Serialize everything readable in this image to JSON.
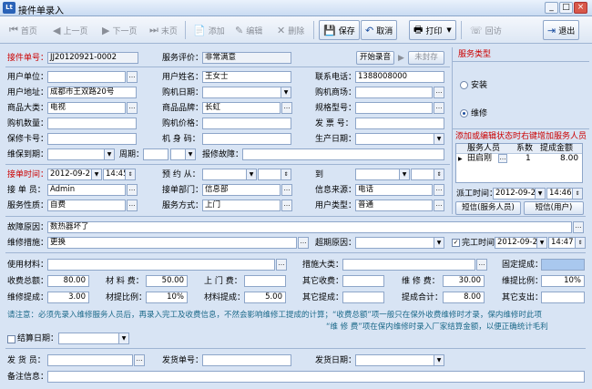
{
  "window": {
    "title": "接件单录入",
    "min": "_",
    "max": "□",
    "close": "×"
  },
  "toolbar": {
    "first": "首页",
    "prev": "上一页",
    "next": "下一页",
    "last": "末页",
    "add": "添加",
    "edit": "编辑",
    "del": "删除",
    "save": "保存",
    "cancel": "取消",
    "print": "打印",
    "visit": "回访",
    "exit": "退出"
  },
  "form": {
    "order_no_label": "接件单号：",
    "order_no": "JJ20120921-0002",
    "rating_label": "服务评价：",
    "rating": "非常满意",
    "start_record": "开始录音",
    "not_sealed": "未封存",
    "user_unit_label": "用户单位：",
    "user_unit": "",
    "user_name_label": "用户姓名：",
    "user_name": "王女士",
    "phone_label": "联系电话：",
    "phone": "1388008000",
    "address_label": "用户地址：",
    "address": "成都市王双路20号",
    "buy_date_label": "购机日期：",
    "buy_date": "",
    "buy_store_label": "购机商场：",
    "buy_store": "",
    "category_label": "商品大类：",
    "category": "电视",
    "brand_label": "商品品牌：",
    "brand": "长虹",
    "model_label": "规格型号：",
    "model": "",
    "qty_label": "购机数量：",
    "qty": "",
    "price_label": "购机价格：",
    "price": "",
    "invoice_label": "发 票 号：",
    "invoice": "",
    "warranty_card_label": "保修卡号：",
    "warranty_card": "",
    "machine_code_label": "机 身 码：",
    "machine_code": "",
    "prod_date_label": "生产日期：",
    "prod_date": "",
    "warranty_exp_label": "维保到期：",
    "warranty_exp": "",
    "period_label": "周期：",
    "period": "",
    "fault_report_label": "报修故障：",
    "fault_report": "",
    "recv_time_label": "接单时间：",
    "recv_date": "2012-09-21",
    "recv_time": "14:45",
    "appt_from_label": "预 约 从：",
    "appt_from": "",
    "appt_to_label": "到",
    "appt_to": "",
    "receiver_label": "接 单 员：",
    "receiver": "Admin",
    "recv_dept_label": "接单部门：",
    "recv_dept": "信息部",
    "info_src_label": "信息来源：",
    "info_src": "电话",
    "svc_nature_label": "服务性质：",
    "svc_nature": "自费",
    "svc_mode_label": "服务方式：",
    "svc_mode": "上门",
    "user_type_label": "用户类型：",
    "user_type": "普通",
    "fault_cause_label": "故障原因：",
    "fault_cause": "数热器坏了",
    "repair_label": "维修措施：",
    "repair": "更换",
    "overdue_label": "超期原因：",
    "overdue": "",
    "finish_label": "完工时间",
    "finish_date": "2012-09-21",
    "finish_time": "14:47",
    "material_label": "使用材料：",
    "material": "",
    "measure_cat_label": "措施大类：",
    "measure_cat": "",
    "fixed_comm_label": "固定提成：",
    "fixed_comm": "",
    "total_label": "收费总额：",
    "total": "80.00",
    "mat_fee_label": "材 料 费：",
    "mat_fee": "50.00",
    "door_fee_label": "上 门 费：",
    "door_fee": "",
    "other_fee_label": "其它收费：",
    "other_fee": "",
    "repair_fee_label": "维 修 费：",
    "repair_fee": "30.00",
    "repair_ratio_label": "维提比例：",
    "repair_ratio": "10%",
    "repair_comm_label": "维修提成：",
    "repair_comm": "3.00",
    "mat_ratio_label": "材提比例：",
    "mat_ratio": "10%",
    "mat_comm_label": "材料提成：",
    "mat_comm": "5.00",
    "other_comm_label": "其它提成：",
    "other_comm": "",
    "comm_total_label": "提成合计：",
    "comm_total": "8.00",
    "other_exp_label": "其它支出：",
    "other_exp": "",
    "note1": "请注意：必须先录入维修服务人员后，再录入完工及收费信息，不然会影响维修工提成的计算；“收费总额”项一般只在保外收费维修时才录，保内维修时此项",
    "note2": "“维 修 费”项在保内维修时录入厂家结算金额，以便正确统计毛利",
    "settle_label": "结算日期：",
    "settle": "",
    "sender_label": "发 货 员：",
    "sender": "",
    "ship_no_label": "发货单号：",
    "ship_no": "",
    "ship_date_label": "发货日期：",
    "ship_date": "",
    "remark_label": "备注信息：",
    "remark": ""
  },
  "right": {
    "svc_type_label": "服务类型",
    "install": "安装",
    "repair": "维修",
    "hint": "添加或编辑状态时右键增加服务人员",
    "col1": "服务人员",
    "col2": "系数",
    "col3": "提成金额",
    "row_name": "田启刚",
    "row_coef": "1",
    "row_amt": "8.00",
    "dispatch_label": "派工时间：",
    "dispatch_date": "2012-09-21",
    "dispatch_time": "14:46",
    "sms_staff": "短信(服务人员)",
    "sms_user": "短信(用户)"
  }
}
